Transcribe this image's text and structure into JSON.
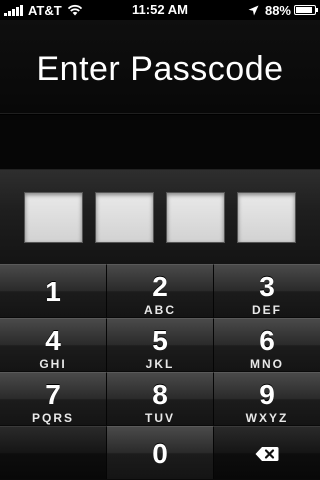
{
  "status_bar": {
    "carrier": "AT&T",
    "time": "11:52 AM",
    "battery_percent": "88%",
    "battery_level": 0.88,
    "icons": [
      "signal-icon",
      "wifi-icon",
      "location-icon",
      "battery-icon"
    ]
  },
  "header": {
    "title": "Enter Passcode"
  },
  "passcode": {
    "digits_entered": 0,
    "total_digits": 4
  },
  "keypad": {
    "keys": [
      {
        "digit": "1",
        "letters": ""
      },
      {
        "digit": "2",
        "letters": "ABC"
      },
      {
        "digit": "3",
        "letters": "DEF"
      },
      {
        "digit": "4",
        "letters": "GHI"
      },
      {
        "digit": "5",
        "letters": "JKL"
      },
      {
        "digit": "6",
        "letters": "MNO"
      },
      {
        "digit": "7",
        "letters": "PQRS"
      },
      {
        "digit": "8",
        "letters": "TUV"
      },
      {
        "digit": "9",
        "letters": "WXYZ"
      },
      {
        "digit": "0",
        "letters": ""
      }
    ],
    "delete_icon": "backspace-icon"
  },
  "colors": {
    "background": "#000000",
    "text": "#ffffff",
    "box_fill": "#e0e0e0"
  }
}
